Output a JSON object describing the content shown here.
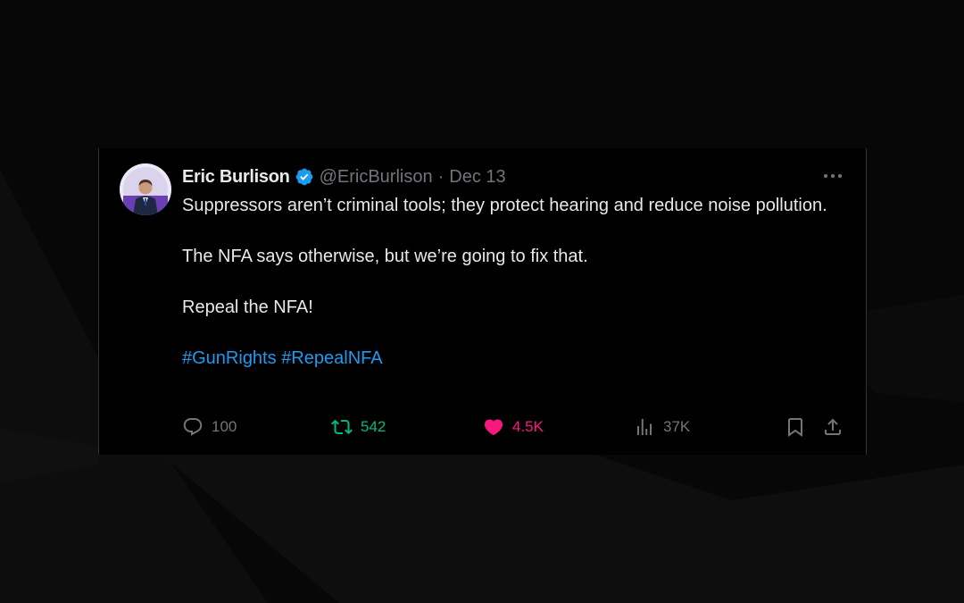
{
  "tweet": {
    "author": {
      "display_name": "Eric Burlison",
      "handle": "@EricBurlison",
      "verified": true
    },
    "separator": "·",
    "timestamp": "Dec 13",
    "lines": [
      "Suppressors aren’t criminal tools; they protect hearing and reduce noise pollution.",
      "The NFA says otherwise, but we’re going to fix that.",
      "Repeal the NFA!"
    ],
    "hashtags": [
      "#GunRights",
      "#RepealNFA"
    ],
    "actions": {
      "replies": "100",
      "retweets": "542",
      "likes": "4.5K",
      "views": "37K"
    },
    "icons": {
      "verified": "verified-badge-icon",
      "more": "more-options-icon",
      "reply": "reply-icon",
      "retweet": "retweet-icon",
      "like": "heart-icon",
      "views": "views-icon",
      "bookmark": "bookmark-icon",
      "share": "share-icon"
    }
  },
  "colors": {
    "background": "#000000",
    "text": "#e7e9ea",
    "muted": "#71767b",
    "link": "#1d9bf0",
    "retweet": "#00ba7c",
    "like": "#f91880"
  }
}
